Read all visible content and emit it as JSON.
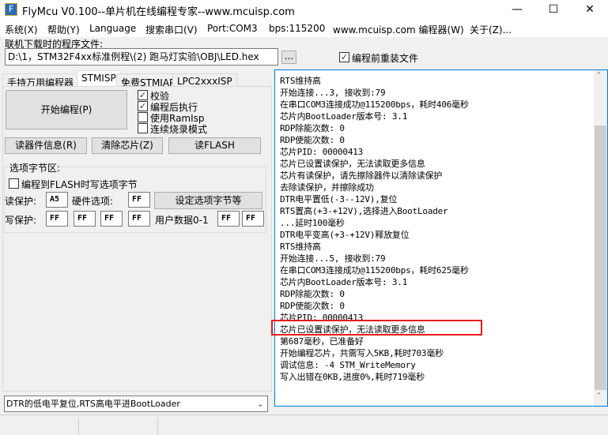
{
  "window": {
    "title": "FlyMcu V0.100--单片机在线编程专家--www.mcuisp.com",
    "minimize": "—",
    "maximize": "☐",
    "close": "✕",
    "icon": "F"
  },
  "menu": [
    "系统(X)",
    "帮助(Y)",
    "Language",
    "搜索串口(V)",
    "Port:COM3",
    "bps:115200",
    "www.mcuisp.com 编程器(W)",
    "关于(Z)..."
  ],
  "file": {
    "label": "联机下载时的程序文件:",
    "path": "D:\\1，STM32F4xx标准例程\\(2) 跑马灯实验\\OBJ\\LED.hex",
    "browse": "...",
    "reload_label": "编程前重装文件",
    "reload_checked": true
  },
  "tabs": [
    "手持万用编程器",
    "STMISP",
    "免费STMIAP",
    "LPC2xxxISP"
  ],
  "stmisp": {
    "start": "开始编程(P)",
    "options": [
      {
        "label": "校验",
        "checked": true
      },
      {
        "label": "编程后执行",
        "checked": true
      },
      {
        "label": "使用RamIsp",
        "checked": false
      },
      {
        "label": "连续烧录模式",
        "checked": false
      }
    ],
    "read_info": "读器件信息(R)",
    "erase": "清除芯片(Z)",
    "read_flash": "读FLASH",
    "option_group": "选项字节区:",
    "write_opt_label": "编程到FLASH时写选项字节",
    "read_protect_label": "读保护:",
    "read_protect": "A5",
    "hw_label": "硬件选项:",
    "hw": "FF",
    "set_btn": "设定选项字节等",
    "write_protect_label": "写保护:",
    "write_protect": [
      "FF",
      "FF",
      "FF",
      "FF"
    ],
    "user_label": "用户数据0-1",
    "user": [
      "FF",
      "FF"
    ]
  },
  "reset_mode": "DTR的低电平复位,RTS高电平进BootLoader",
  "log": [
    "RTS维持高",
    "开始连接...3, 接收到:79",
    "在串口COM3连接成功@115200bps，耗时406毫秒",
    "芯片内BootLoader版本号: 3.1",
    "RDP除能次数: 0",
    "RDP使能次数: 0",
    "芯片PID: 00000413",
    "芯片已设置读保护，无法读取更多信息",
    "芯片有读保护，请先擦除器件以清除读保护",
    "去除读保护，并擦除成功",
    "DTR电平置低(-3--12V),复位",
    "RTS置高(+3-+12V),选择进入BootLoader",
    "...延时100毫秒",
    "DTR电平变高(+3-+12V)释放复位",
    "RTS维持高",
    "开始连接...5, 接收到:79",
    "在串口COM3连接成功@115200bps，耗时625毫秒",
    "芯片内BootLoader版本号: 3.1",
    "RDP除能次数: 0",
    "RDP使能次数: 0",
    "芯片PID: 00000413",
    "芯片已设置读保护，无法读取更多信息",
    "第687毫秒，已准备好",
    "开始编程芯片，共需写入5KB,耗时703毫秒",
    "调试信息: -4 STM_WriteMemory",
    "写入出错在0KB,进度0%,耗时719毫秒"
  ],
  "highlight_color": "#e81b1b"
}
